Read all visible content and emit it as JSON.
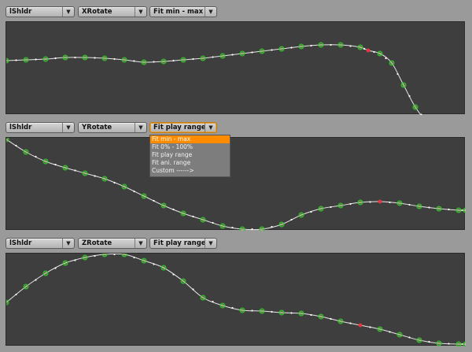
{
  "panels": [
    {
      "joint": "lShldr",
      "channel": "XRotate",
      "fit_mode": "Fit min - max",
      "curve": [
        [
          0,
          49
        ],
        [
          25,
          48
        ],
        [
          50,
          47
        ],
        [
          75,
          45
        ],
        [
          100,
          45
        ],
        [
          125,
          46
        ],
        [
          150,
          48
        ],
        [
          175,
          51
        ],
        [
          200,
          50
        ],
        [
          225,
          48
        ],
        [
          250,
          46
        ],
        [
          275,
          43
        ],
        [
          300,
          40
        ],
        [
          325,
          37
        ],
        [
          350,
          34
        ],
        [
          375,
          31
        ],
        [
          400,
          29
        ],
        [
          425,
          29
        ],
        [
          450,
          32
        ],
        [
          460,
          36
        ],
        [
          475,
          40
        ],
        [
          490,
          52
        ],
        [
          505,
          80
        ],
        [
          520,
          108
        ],
        [
          535,
          127
        ],
        [
          550,
          136
        ],
        [
          565,
          141
        ],
        [
          580,
          142
        ],
        [
          584,
          142
        ]
      ],
      "highlight_index": 19
    },
    {
      "joint": "lShldr",
      "channel": "YRotate",
      "fit_mode": "Fit play range",
      "curve": [
        [
          0,
          2
        ],
        [
          25,
          18
        ],
        [
          50,
          30
        ],
        [
          75,
          38
        ],
        [
          100,
          45
        ],
        [
          125,
          52
        ],
        [
          150,
          62
        ],
        [
          175,
          74
        ],
        [
          200,
          86
        ],
        [
          225,
          96
        ],
        [
          250,
          104
        ],
        [
          275,
          112
        ],
        [
          300,
          116
        ],
        [
          325,
          116
        ],
        [
          350,
          110
        ],
        [
          375,
          98
        ],
        [
          400,
          90
        ],
        [
          425,
          86
        ],
        [
          450,
          82
        ],
        [
          475,
          81
        ],
        [
          500,
          83
        ],
        [
          525,
          87
        ],
        [
          550,
          90
        ],
        [
          575,
          92
        ],
        [
          584,
          92
        ]
      ],
      "highlight_index": 19
    },
    {
      "joint": "lShldr",
      "channel": "ZRotate",
      "fit_mode": "Fit play range",
      "curve": [
        [
          0,
          62
        ],
        [
          25,
          42
        ],
        [
          50,
          25
        ],
        [
          75,
          12
        ],
        [
          100,
          5
        ],
        [
          125,
          1
        ],
        [
          150,
          1
        ],
        [
          175,
          9
        ],
        [
          200,
          18
        ],
        [
          225,
          35
        ],
        [
          250,
          56
        ],
        [
          275,
          66
        ],
        [
          300,
          72
        ],
        [
          325,
          73
        ],
        [
          350,
          75
        ],
        [
          375,
          76
        ],
        [
          400,
          80
        ],
        [
          425,
          86
        ],
        [
          450,
          91
        ],
        [
          475,
          96
        ],
        [
          500,
          103
        ],
        [
          525,
          110
        ],
        [
          550,
          114
        ],
        [
          575,
          115
        ],
        [
          584,
          115
        ]
      ],
      "highlight_index": 18
    }
  ],
  "fit_menu": {
    "items": [
      "Fit min - max",
      "Fit 0% - 100%",
      "Fit play range",
      "Fit ani. range",
      "Custom ------>"
    ],
    "selected_index": 0
  },
  "icons": {
    "dropdown": "dropdown-arrow-icon"
  },
  "colors": {
    "panel_bg": "#3e3e3e",
    "curve": "#e6e6e6",
    "keyframe": "#28c828",
    "keyframe_fill": "#9be04f",
    "keyframe_selected": "#e0383c",
    "menu_selected": "#ff8c00"
  }
}
